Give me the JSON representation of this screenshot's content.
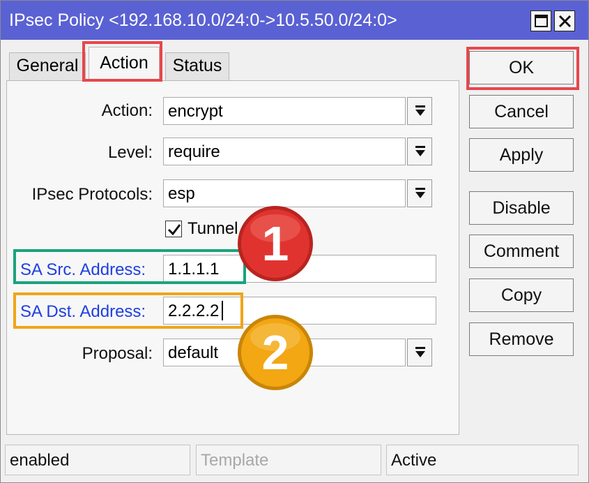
{
  "window": {
    "title": "IPsec Policy <192.168.10.0/24:0->10.5.50.0/24:0>"
  },
  "tabs": [
    {
      "label": "General",
      "active": false
    },
    {
      "label": "Action",
      "active": true
    },
    {
      "label": "Status",
      "active": false
    }
  ],
  "form": {
    "action": {
      "label": "Action:",
      "value": "encrypt"
    },
    "level": {
      "label": "Level:",
      "value": "require"
    },
    "ipsec_protocols": {
      "label": "IPsec Protocols:",
      "value": "esp"
    },
    "tunnel": {
      "label": "Tunnel",
      "checked": true
    },
    "sa_src": {
      "label": "SA Src. Address:",
      "value": "1.1.1.1"
    },
    "sa_dst": {
      "label": "SA Dst. Address:",
      "value": "2.2.2.2"
    },
    "proposal": {
      "label": "Proposal:",
      "value": "default"
    }
  },
  "buttons": {
    "ok": "OK",
    "cancel": "Cancel",
    "apply": "Apply",
    "disable": "Disable",
    "comment": "Comment",
    "copy": "Copy",
    "remove": "Remove"
  },
  "annotations": {
    "badge1": "1",
    "badge2": "2"
  },
  "statusbar": {
    "state": "enabled",
    "template": "Template",
    "active": "Active"
  },
  "colors": {
    "titlebar": "#5a61d3",
    "highlight_red": "#e8464c",
    "highlight_teal": "#1aa37c",
    "highlight_orange": "#f0a51a",
    "badge_red": "#e0332f",
    "badge_orange": "#f2a713"
  }
}
